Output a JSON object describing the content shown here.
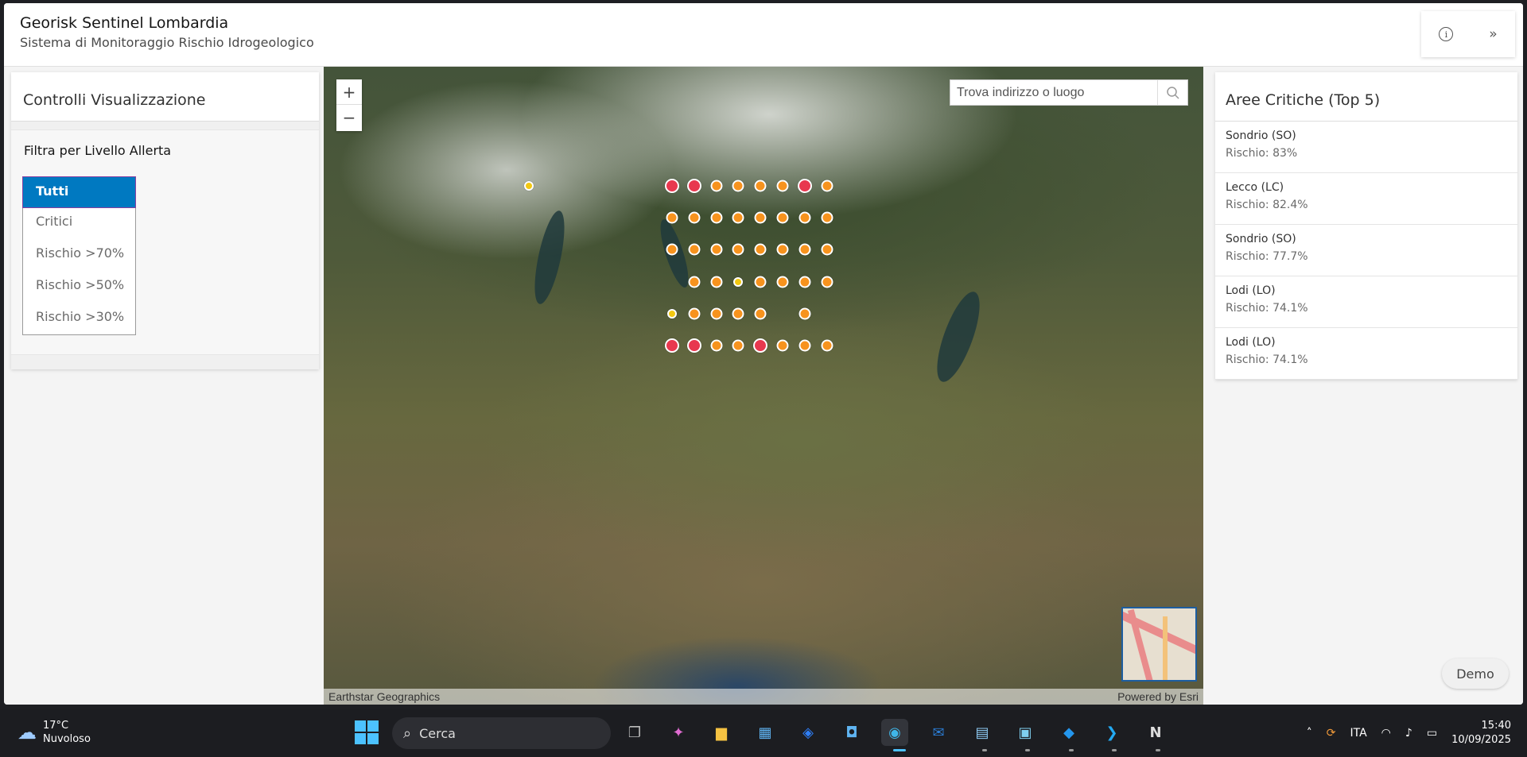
{
  "header": {
    "title": "Georisk Sentinel Lombardia",
    "subtitle": "Sistema di Monitoraggio Rischio Idrogeologico",
    "info_icon": "info-icon",
    "expand_icon": "double-chevron-right-icon"
  },
  "left_panel": {
    "title": "Controlli Visualizzazione",
    "filter_label": "Filtra per Livello Allerta",
    "filter_options": [
      "Tutti",
      "Critici",
      "Rischio >70%",
      "Rischio >50%",
      "Rischio >30%"
    ],
    "selected_option": "Tutti"
  },
  "map": {
    "zoom_in": "+",
    "zoom_out": "−",
    "search_placeholder": "Trova indirizzo o luogo",
    "attribution_left": "Earthstar Geographics",
    "attribution_right": "Powered by Esri",
    "marker_colors": {
      "critical": "#e8384f",
      "high": "#f7931e",
      "medium": "#f2c811"
    }
  },
  "right_panel": {
    "title": "Aree Critiche (Top 5)",
    "areas": [
      {
        "name": "Sondrio (SO)",
        "risk": "Rischio: 83%"
      },
      {
        "name": "Lecco (LC)",
        "risk": "Rischio: 82.4%"
      },
      {
        "name": "Sondrio (SO)",
        "risk": "Rischio: 77.7%"
      },
      {
        "name": "Lodi (LO)",
        "risk": "Rischio: 74.1%"
      },
      {
        "name": "Lodi (LO)",
        "risk": "Rischio: 74.1%"
      }
    ]
  },
  "demo_button": "Demo",
  "taskbar": {
    "weather_temp": "17°C",
    "weather_desc": "Nuvoloso",
    "search_label": "Cerca",
    "language": "ITA",
    "time": "15:40",
    "date": "10/09/2025"
  }
}
